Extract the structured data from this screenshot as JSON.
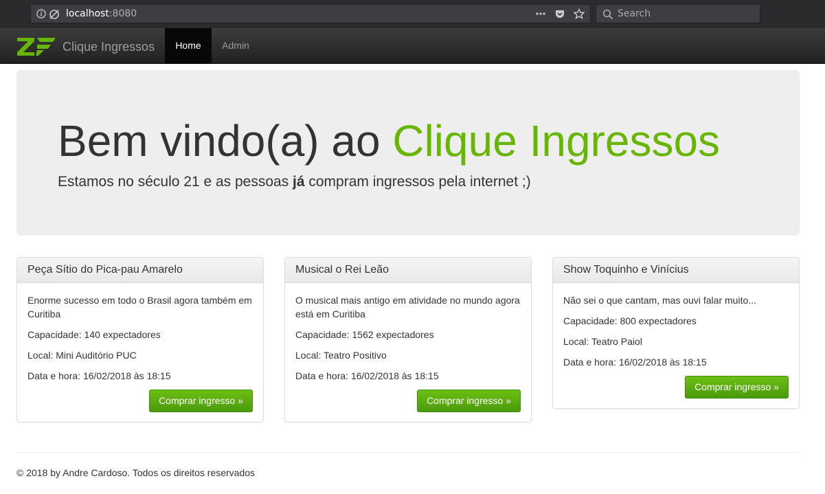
{
  "browser": {
    "url_host": "localhost",
    "url_port": ":8080",
    "search_placeholder": "Search"
  },
  "navbar": {
    "brand": "Clique Ingressos",
    "items": [
      {
        "label": "Home",
        "active": true
      },
      {
        "label": "Admin",
        "active": false
      }
    ]
  },
  "jumbotron": {
    "title_prefix": "Bem vindo(a) ao ",
    "title_accent": "Clique Ingressos",
    "subtitle_before": "Estamos no século 21 e as pessoas ",
    "subtitle_bold": "já",
    "subtitle_after": " compram ingressos pela internet ;)"
  },
  "events": [
    {
      "title": "Peça Sítio do Pica-pau Amarelo",
      "description": "Enorme sucesso em todo o Brasil agora também em Curitiba",
      "capacity": "Capacidade: 140 expectadores",
      "location": "Local: Mini Auditório PUC",
      "datetime": "Data e hora: 16/02/2018 às 18:15",
      "button": "Comprar ingresso »"
    },
    {
      "title": "Musical o Rei Leão",
      "description": "O musical mais antigo em atividade no mundo agora está em Curitiba",
      "capacity": "Capacidade: 1562 expectadores",
      "location": "Local: Teatro Positivo",
      "datetime": "Data e hora: 16/02/2018 às 18:15",
      "button": "Comprar ingresso »"
    },
    {
      "title": "Show Toquinho e Vinícius",
      "description": "Não sei o que cantam, mas ouvi falar muito...",
      "capacity": "Capacidade: 800 expectadores",
      "location": "Local: Teatro Paiol",
      "datetime": "Data e hora: 16/02/2018 às 18:15",
      "button": "Comprar ingresso »"
    }
  ],
  "footer": {
    "text": "© 2018 by Andre Cardoso. Todos os direitos reservados"
  },
  "colors": {
    "accent": "#68b604",
    "button": "#5aac10",
    "navbar": "#222222"
  }
}
